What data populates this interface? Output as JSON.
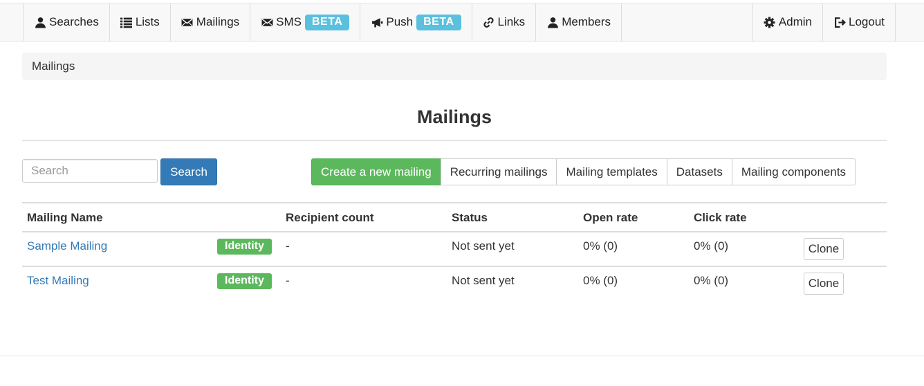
{
  "nav": {
    "left": [
      {
        "label": "Searches",
        "icon": "user-icon"
      },
      {
        "label": "Lists",
        "icon": "list-icon"
      },
      {
        "label": "Mailings",
        "icon": "envelope-icon"
      },
      {
        "label": "SMS",
        "icon": "envelope-icon",
        "badge": "BETA"
      },
      {
        "label": "Push",
        "icon": "bullhorn-icon",
        "badge": "BETA"
      },
      {
        "label": "Links",
        "icon": "link-icon"
      },
      {
        "label": "Members",
        "icon": "user-icon"
      }
    ],
    "right": [
      {
        "label": "Admin",
        "icon": "cog-icon"
      },
      {
        "label": "Logout",
        "icon": "logout-icon"
      }
    ]
  },
  "breadcrumb": "Mailings",
  "page_title": "Mailings",
  "search": {
    "placeholder": "Search",
    "button": "Search"
  },
  "actions": [
    "Create a new mailing",
    "Recurring mailings",
    "Mailing templates",
    "Datasets",
    "Mailing components"
  ],
  "table": {
    "headers": [
      "Mailing Name",
      "Recipient count",
      "Status",
      "Open rate",
      "Click rate"
    ],
    "rows": [
      {
        "name": "Sample Mailing",
        "label": "Identity",
        "recipients": "-",
        "status": "Not sent yet",
        "open_rate": "0% (0)",
        "click_rate": "0% (0)",
        "action": "Clone"
      },
      {
        "name": "Test Mailing",
        "label": "Identity",
        "recipients": "-",
        "status": "Not sent yet",
        "open_rate": "0% (0)",
        "click_rate": "0% (0)",
        "action": "Clone"
      }
    ]
  },
  "colors": {
    "primary": "#337ab7",
    "success": "#5cb85c",
    "info": "#5bc0de"
  }
}
